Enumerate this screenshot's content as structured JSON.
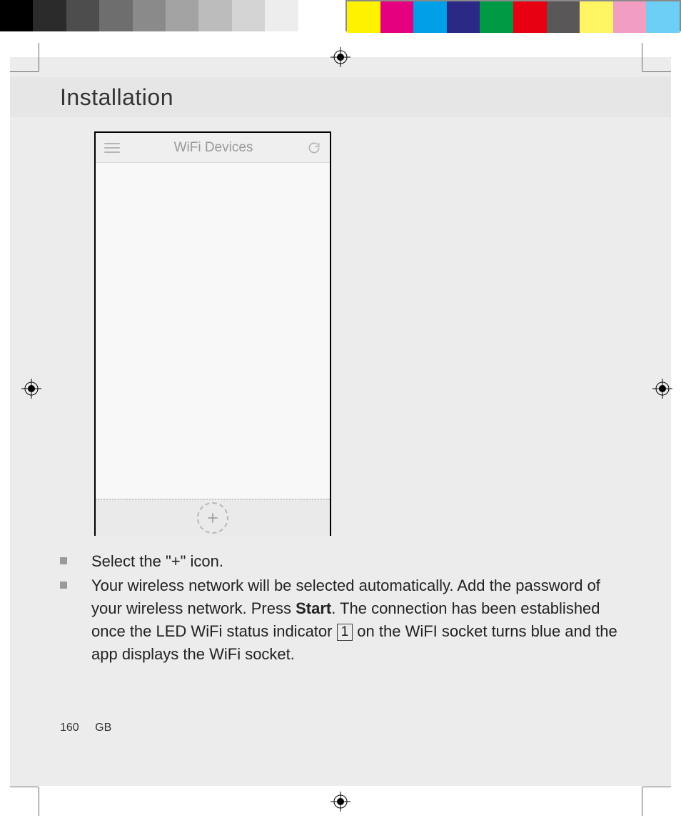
{
  "colorbars": {
    "left": [
      "#000000",
      "#2b2b2b",
      "#4d4d4d",
      "#6e6e6e",
      "#8a8a8a",
      "#a3a3a3",
      "#bcbcbc",
      "#d4d4d4",
      "#ededed",
      "#ffffff"
    ],
    "right": [
      "#fff200",
      "#e4007f",
      "#00a0e9",
      "#2a2a86",
      "#009944",
      "#e60012",
      "#595757",
      "#fff462",
      "#f19ec2",
      "#6ecff6"
    ],
    "border": "#8a8a8a"
  },
  "heading": "Installation",
  "device": {
    "title": "WiFi Devices",
    "menu_icon": "hamburger-icon",
    "refresh_icon": "refresh-icon",
    "add_icon": "plus-icon"
  },
  "bullets": [
    {
      "text_before": "Select the \"+\" icon.",
      "bold": "",
      "text_after": "",
      "key": ""
    },
    {
      "text_before": "Your wireless network will be selected automatically. Add the password of your wireless network. Press ",
      "bold": "Start",
      "text_mid": ". The connection has been established once the LED WiFi status indicator ",
      "key": "1",
      "text_after": " on the WiFI socket turns blue and the app displays the WiFi socket."
    }
  ],
  "footer": {
    "page": "160",
    "region": "GB"
  }
}
